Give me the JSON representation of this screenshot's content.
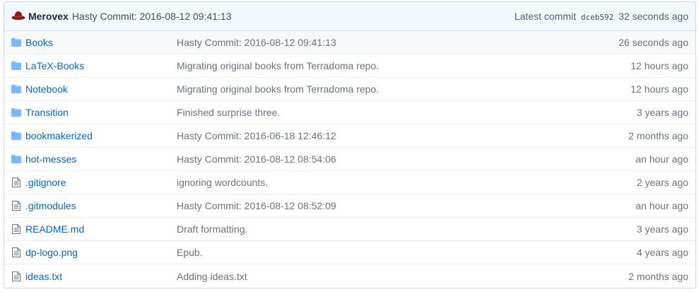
{
  "commit_bar": {
    "author": "Merovex",
    "message": "Hasty Commit: 2016-08-12 09:41:13",
    "latest_label": "Latest commit",
    "sha": "dceb592",
    "age": "32 seconds ago"
  },
  "files": [
    {
      "type": "folder",
      "name": "Books",
      "message": "Hasty Commit: 2016-08-12 09:41:13",
      "age": "26 seconds ago"
    },
    {
      "type": "folder",
      "name": "LaTeX-Books",
      "message": "Migrating original books from Terradoma repo.",
      "age": "12 hours ago"
    },
    {
      "type": "folder",
      "name": "Notebook",
      "message": "Migrating original books from Terradoma repo.",
      "age": "12 hours ago"
    },
    {
      "type": "folder",
      "name": "Transition",
      "message": "Finished surprise three.",
      "age": "3 years ago"
    },
    {
      "type": "folder",
      "name": "bookmakerized",
      "message": "Hasty Commit: 2016-06-18 12:46:12",
      "age": "2 months ago"
    },
    {
      "type": "folder",
      "name": "hot-messes",
      "message": "Hasty Commit: 2016-08-12 08:54:06",
      "age": "an hour ago"
    },
    {
      "type": "file",
      "name": ".gitignore",
      "message": "ignoring wordcounts.",
      "age": "2 years ago"
    },
    {
      "type": "file",
      "name": ".gitmodules",
      "message": "Hasty Commit: 2016-08-12 08:52:09",
      "age": "an hour ago"
    },
    {
      "type": "file",
      "name": "README.md",
      "message": "Draft formatting.",
      "age": "3 years ago"
    },
    {
      "type": "file",
      "name": "dp-logo.png",
      "message": "Epub.",
      "age": "4 years ago"
    },
    {
      "type": "file",
      "name": "ideas.txt",
      "message": "Adding ideas.txt",
      "age": "2 months ago"
    }
  ],
  "colors": {
    "link": "#0366d6",
    "folder_icon": "#79b8ff",
    "file_icon": "#6a737d",
    "commit_bar_bg": "#f1f8ff",
    "avatar": "#8b1a1a"
  }
}
